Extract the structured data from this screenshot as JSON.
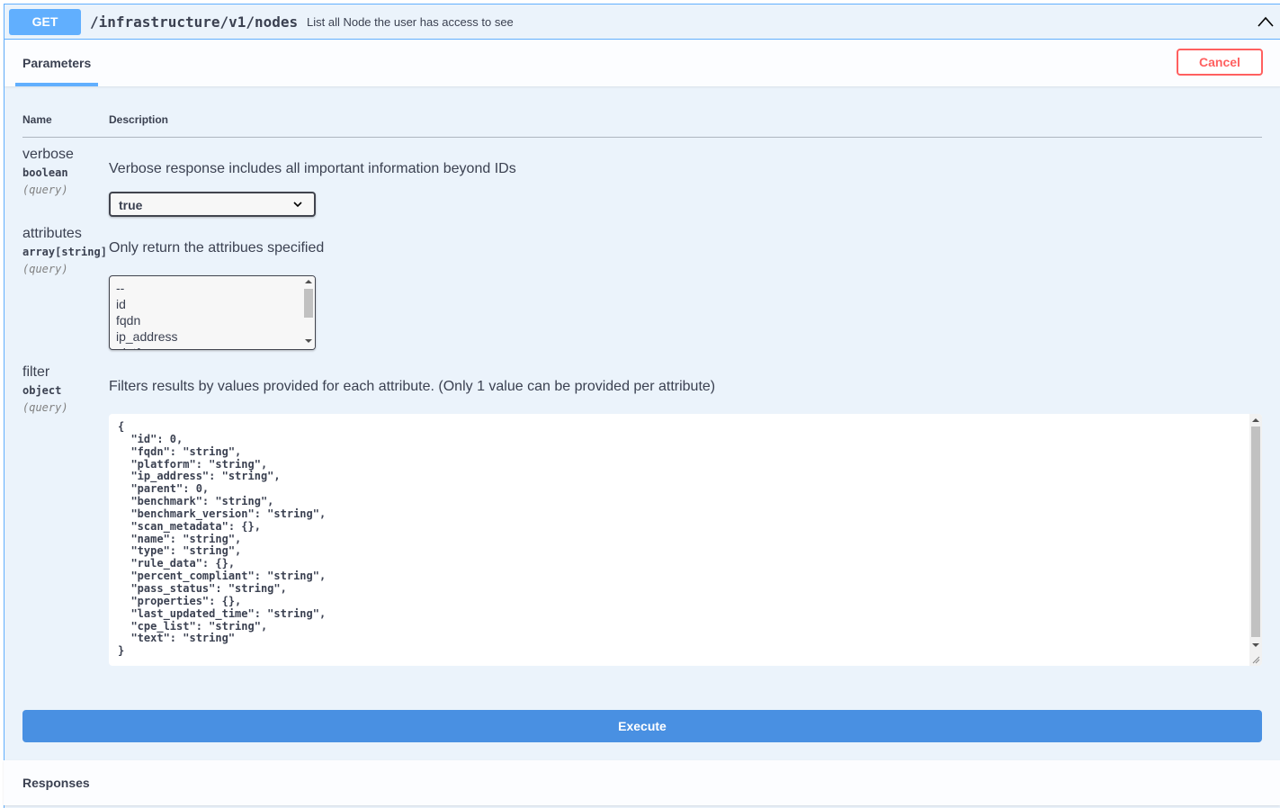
{
  "summary": {
    "method": "GET",
    "path": "/infrastructure/v1/nodes",
    "description": "List all Node the user has access to see",
    "collapse_icon": "chevron-up-icon"
  },
  "section": {
    "tab_label": "Parameters",
    "cancel_label": "Cancel"
  },
  "table": {
    "col_name": "Name",
    "col_description": "Description"
  },
  "params": [
    {
      "name": "verbose",
      "type": "boolean",
      "in": "(query)",
      "description": "Verbose response includes all important information beyond IDs",
      "selected": "true"
    },
    {
      "name": "attributes",
      "type": "array[string]",
      "in": "(query)",
      "description": "Only return the attribues specified",
      "options": [
        "--",
        "id",
        "fqdn",
        "ip_address"
      ]
    },
    {
      "name": "filter",
      "type": "object",
      "in": "(query)",
      "description": "Filters results by values provided for each attribute. (Only 1 value can be provided per attribute)",
      "value": "{\n  \"id\": 0,\n  \"fqdn\": \"string\",\n  \"platform\": \"string\",\n  \"ip_address\": \"string\",\n  \"parent\": 0,\n  \"benchmark\": \"string\",\n  \"benchmark_version\": \"string\",\n  \"scan_metadata\": {},\n  \"name\": \"string\",\n  \"type\": \"string\",\n  \"rule_data\": {},\n  \"percent_compliant\": \"string\",\n  \"pass_status\": \"string\",\n  \"properties\": {},\n  \"last_updated_time\": \"string\",\n  \"cpe_list\": \"string\",\n  \"text\": \"string\"\n}"
    }
  ],
  "execute_label": "Execute",
  "responses_label": "Responses",
  "colors": {
    "get_blue": "#61affe",
    "execute_blue": "#4990e2",
    "cancel_red": "#ff6060",
    "block_bg": "#ebf3fb",
    "text": "#3b4151"
  }
}
